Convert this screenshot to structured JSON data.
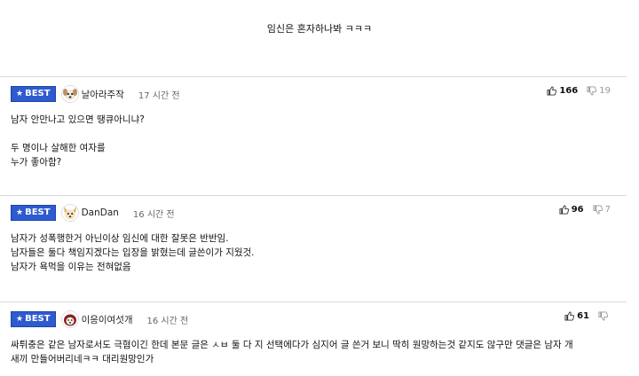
{
  "caption": "임신은 혼자하나봐 ㅋㅋㅋ",
  "best_label": "BEST",
  "comments": [
    {
      "nickname": "날아라주작",
      "time": "17 시간 전",
      "likes": "166",
      "dislikes": "19",
      "lines": [
        "남자 안만나고 있으면 땡큐아니냐?",
        "",
        "두 명이나 살해한 여자를",
        "누가 좋아함?"
      ]
    },
    {
      "nickname": "DanDan",
      "time": "16 시간 전",
      "likes": "96",
      "dislikes": "7",
      "lines": [
        "남자가 성폭행한거 아닌이상 임신에 대한 잘못은 반반임.",
        "남자들은 둘다 책임지겠다는 입장을 밝혔는데 글쓴이가 지웠것.",
        "남자가 욕먹을 이유는 전혀없음"
      ]
    },
    {
      "nickname": "이응이여섯개",
      "time": "16 시간 전",
      "likes": "61",
      "dislikes": "",
      "lines": [
        "싸튀충은 같은 남자로서도 극혐이긴 한데 본문 글은 ㅅㅂ 둘 다 지 선택에다가 심지어 글 쓴거 보니 딱히 원망하는것 같지도 않구만 댓글은 남자 개",
        "새끼 만들어버리네ㅋㅋ 대리원망인가"
      ]
    }
  ],
  "icons": {
    "like": "thumbs-up-icon",
    "dislike": "thumbs-down-icon",
    "star": "star-icon"
  },
  "colors": {
    "badge": "#2f5bd0"
  }
}
